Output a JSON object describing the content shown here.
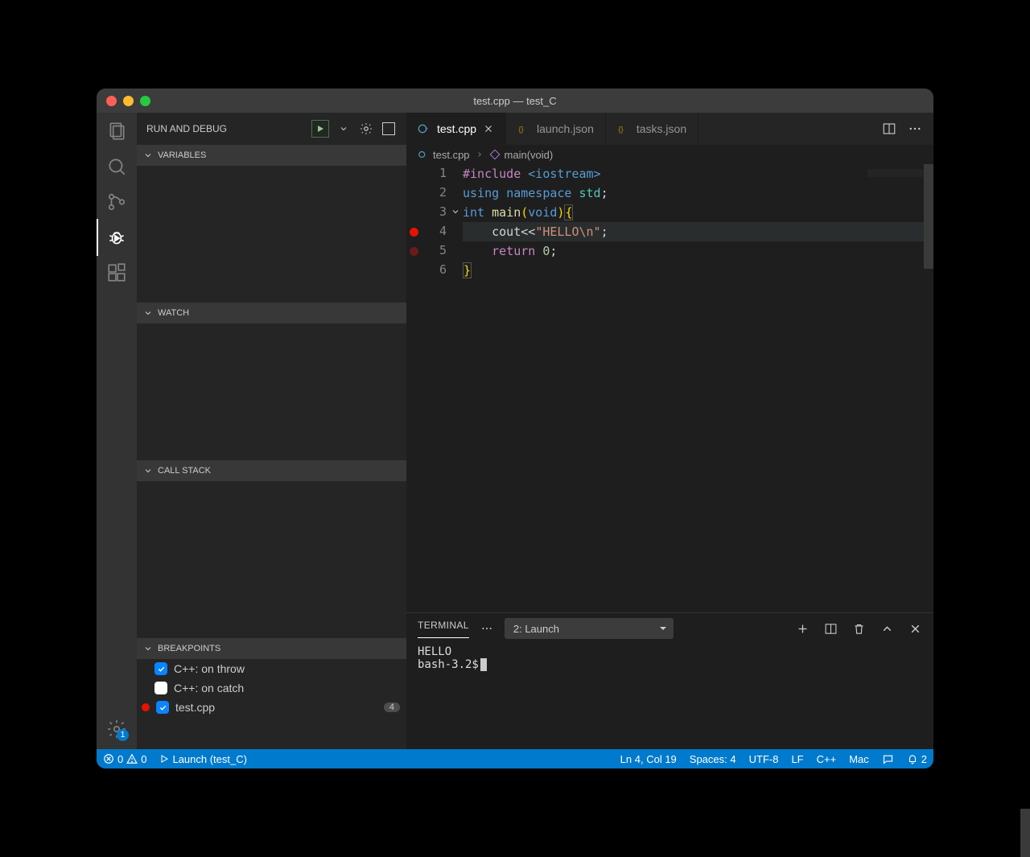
{
  "window": {
    "title": "test.cpp — test_C"
  },
  "activity": {
    "manage_badge": "1"
  },
  "debug": {
    "title": "RUN AND DEBUG",
    "sections": {
      "variables": "VARIABLES",
      "watch": "WATCH",
      "callstack": "CALL STACK",
      "breakpoints": "BREAKPOINTS"
    },
    "breakpoints": {
      "0": {
        "label": "C++: on throw",
        "checked": true
      },
      "1": {
        "label": "C++: on catch",
        "checked": false
      },
      "2": {
        "label": "test.cpp",
        "count": "4"
      }
    }
  },
  "tabs": {
    "0": {
      "label": "test.cpp"
    },
    "1": {
      "label": "launch.json"
    },
    "2": {
      "label": "tasks.json"
    }
  },
  "breadcrumb": {
    "file": "test.cpp",
    "symbol": "main(void)"
  },
  "code": {
    "1": "#include <iostream>",
    "2_a": "using",
    "2_b": "namespace",
    "2_c": "std",
    "3_a": "int",
    "3_b": "main",
    "3_c": "void",
    "4_a": "cout",
    "4_b": "\"HELLO\\n\"",
    "5_a": "return",
    "5_b": "0",
    "linenos": {
      "1": "1",
      "2": "2",
      "3": "3",
      "4": "4",
      "5": "5",
      "6": "6"
    }
  },
  "terminal": {
    "tab": "TERMINAL",
    "select": "2: Launch",
    "output_line1": "HELLO",
    "prompt": "bash-3.2$"
  },
  "status": {
    "errors": "0",
    "warnings": "0",
    "launch": "Launch (test_C)",
    "position": "Ln 4, Col 19",
    "spaces": "Spaces: 4",
    "encoding": "UTF-8",
    "eol": "LF",
    "lang": "C++",
    "os": "Mac",
    "notifications": "2"
  }
}
